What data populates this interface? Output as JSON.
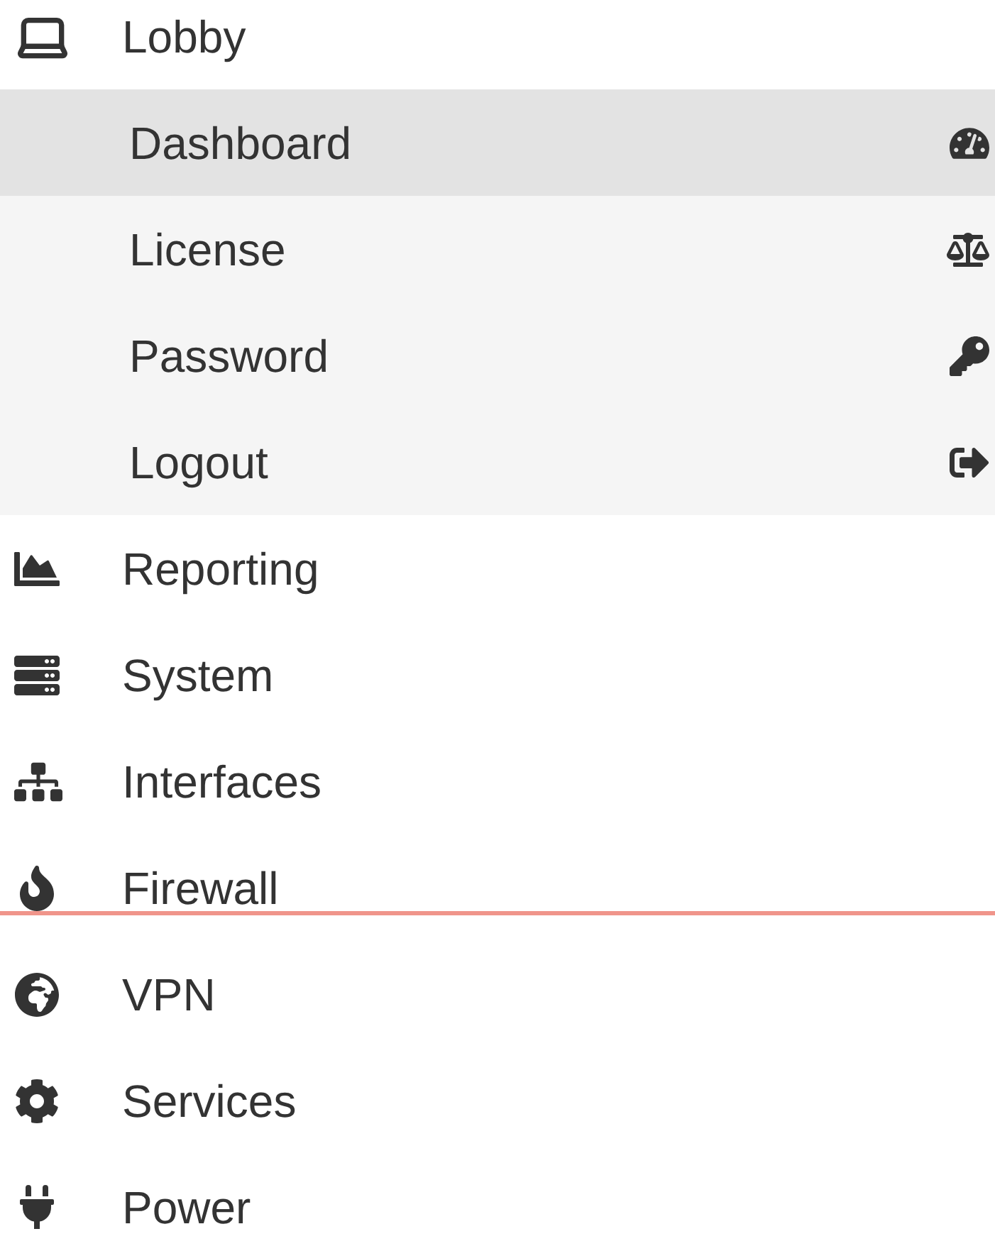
{
  "menu": [
    {
      "label": "Lobby",
      "expanded": true,
      "children": [
        {
          "label": "Dashboard",
          "selected": true
        },
        {
          "label": "License",
          "selected": false
        },
        {
          "label": "Password",
          "selected": false
        },
        {
          "label": "Logout",
          "selected": false
        }
      ]
    },
    {
      "label": "Reporting"
    },
    {
      "label": "System"
    },
    {
      "label": "Interfaces"
    },
    {
      "label": "Firewall"
    },
    {
      "label": "VPN"
    },
    {
      "label": "Services"
    },
    {
      "label": "Power"
    }
  ]
}
